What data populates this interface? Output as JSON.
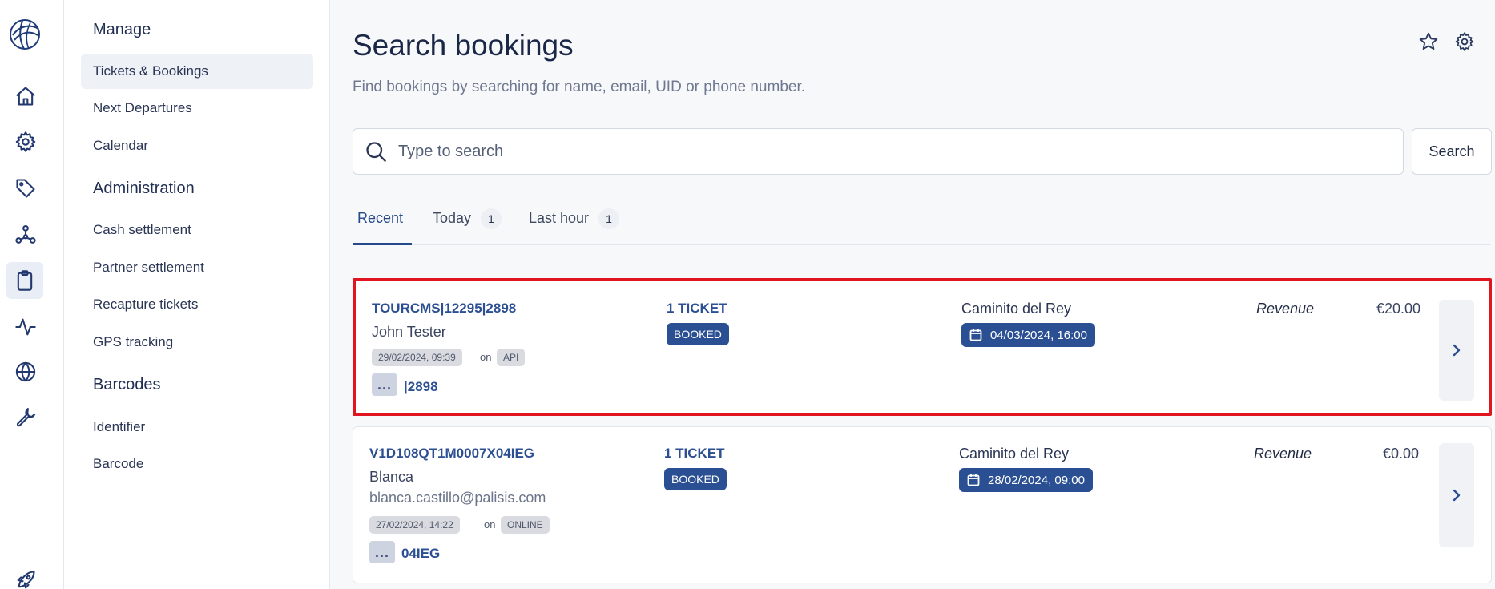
{
  "nav": {
    "groups": [
      {
        "title": "Manage",
        "items": [
          "Tickets & Bookings",
          "Next Departures",
          "Calendar"
        ]
      },
      {
        "title": "Administration",
        "items": [
          "Cash settlement",
          "Partner settlement",
          "Recapture tickets",
          "GPS tracking"
        ]
      },
      {
        "title": "Barcodes",
        "items": [
          "Identifier",
          "Barcode"
        ]
      }
    ],
    "active_item": "Tickets & Bookings"
  },
  "rail_icons": [
    "logo-icon",
    "home-icon",
    "gear-icon",
    "tag-icon",
    "network-icon",
    "clipboard-icon",
    "activity-icon",
    "globe-icon",
    "wrench-icon",
    "rocket-icon"
  ],
  "page": {
    "title": "Search bookings",
    "subtitle": "Find bookings by searching for name, email, UID or phone number.",
    "search_placeholder": "Type to search",
    "search_button": "Search"
  },
  "tabs": [
    {
      "label": "Recent",
      "count": null
    },
    {
      "label": "Today",
      "count": "1"
    },
    {
      "label": "Last hour",
      "count": "1"
    }
  ],
  "bookings": [
    {
      "uid": "TOURCMS|12295|2898",
      "name": "John Tester",
      "email": "",
      "created": "29/02/2024, 09:39",
      "on": "on",
      "channel": "API",
      "dots": "...",
      "ref": "|2898",
      "tickets": "1 TICKET",
      "status": "BOOKED",
      "product": "Caminito del Rey",
      "departure": "04/03/2024, 16:00",
      "revenue_label": "Revenue",
      "revenue": "€20.00"
    },
    {
      "uid": "V1D108QT1M0007X04IEG",
      "name": "Blanca",
      "email": "blanca.castillo@palisis.com",
      "created": "27/02/2024, 14:22",
      "on": "on",
      "channel": "ONLINE",
      "dots": "...",
      "ref": "04IEG",
      "tickets": "1 TICKET",
      "status": "BOOKED",
      "product": "Caminito del Rey",
      "departure": "28/02/2024, 09:00",
      "revenue_label": "Revenue",
      "revenue": "€0.00"
    }
  ],
  "colors": {
    "accent": "#2a4f93",
    "highlight": "#e0151f",
    "background": "#f7f8fa"
  }
}
